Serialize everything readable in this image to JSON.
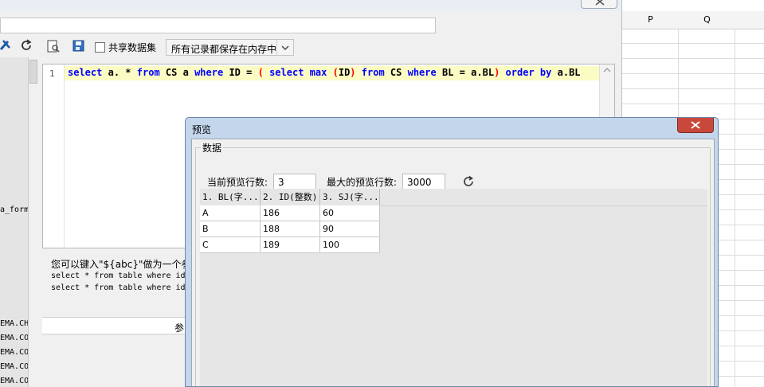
{
  "spreadsheet": {
    "columns": [
      "P",
      "Q",
      ""
    ]
  },
  "toolbar": {
    "share_dataset_label": "共享数据集",
    "storage_mode": "所有记录都保存在内存中"
  },
  "left_panel": {
    "items": [
      "a_form",
      "EMA.CH",
      "EMA.CO",
      "EMA.CO",
      "EMA.CO",
      "EMA.CO"
    ]
  },
  "editor": {
    "line_number": "1",
    "sql": "select a. * from CS a where ID = ( select max (ID) from CS where BL = a.BL) order by a.BL"
  },
  "hint": {
    "title": "您可以键入\"${abc}\"做为一个参",
    "line1": "select * from table where id",
    "line2": "select * from table where id"
  },
  "param_bar": {
    "label": "参"
  },
  "dialog": {
    "title": "预览",
    "group_title": "数据",
    "current_rows_label": "当前预览行数:",
    "current_rows_value": "3",
    "max_rows_label": "最大的预览行数:",
    "max_rows_value": "3000",
    "table": {
      "headers": [
        "1. BL(字...",
        "2. ID(整数)",
        "3. SJ(字..."
      ],
      "rows": [
        [
          "A",
          "186",
          "60"
        ],
        [
          "B",
          "188",
          "90"
        ],
        [
          "C",
          "189",
          "100"
        ]
      ]
    }
  },
  "colors": {
    "keyword": "#0000ff",
    "paren": "#ff0000",
    "line_highlight": "#fbfbc4",
    "dialog_frame": "#c4d6ec",
    "close_button": "#c9483c"
  }
}
